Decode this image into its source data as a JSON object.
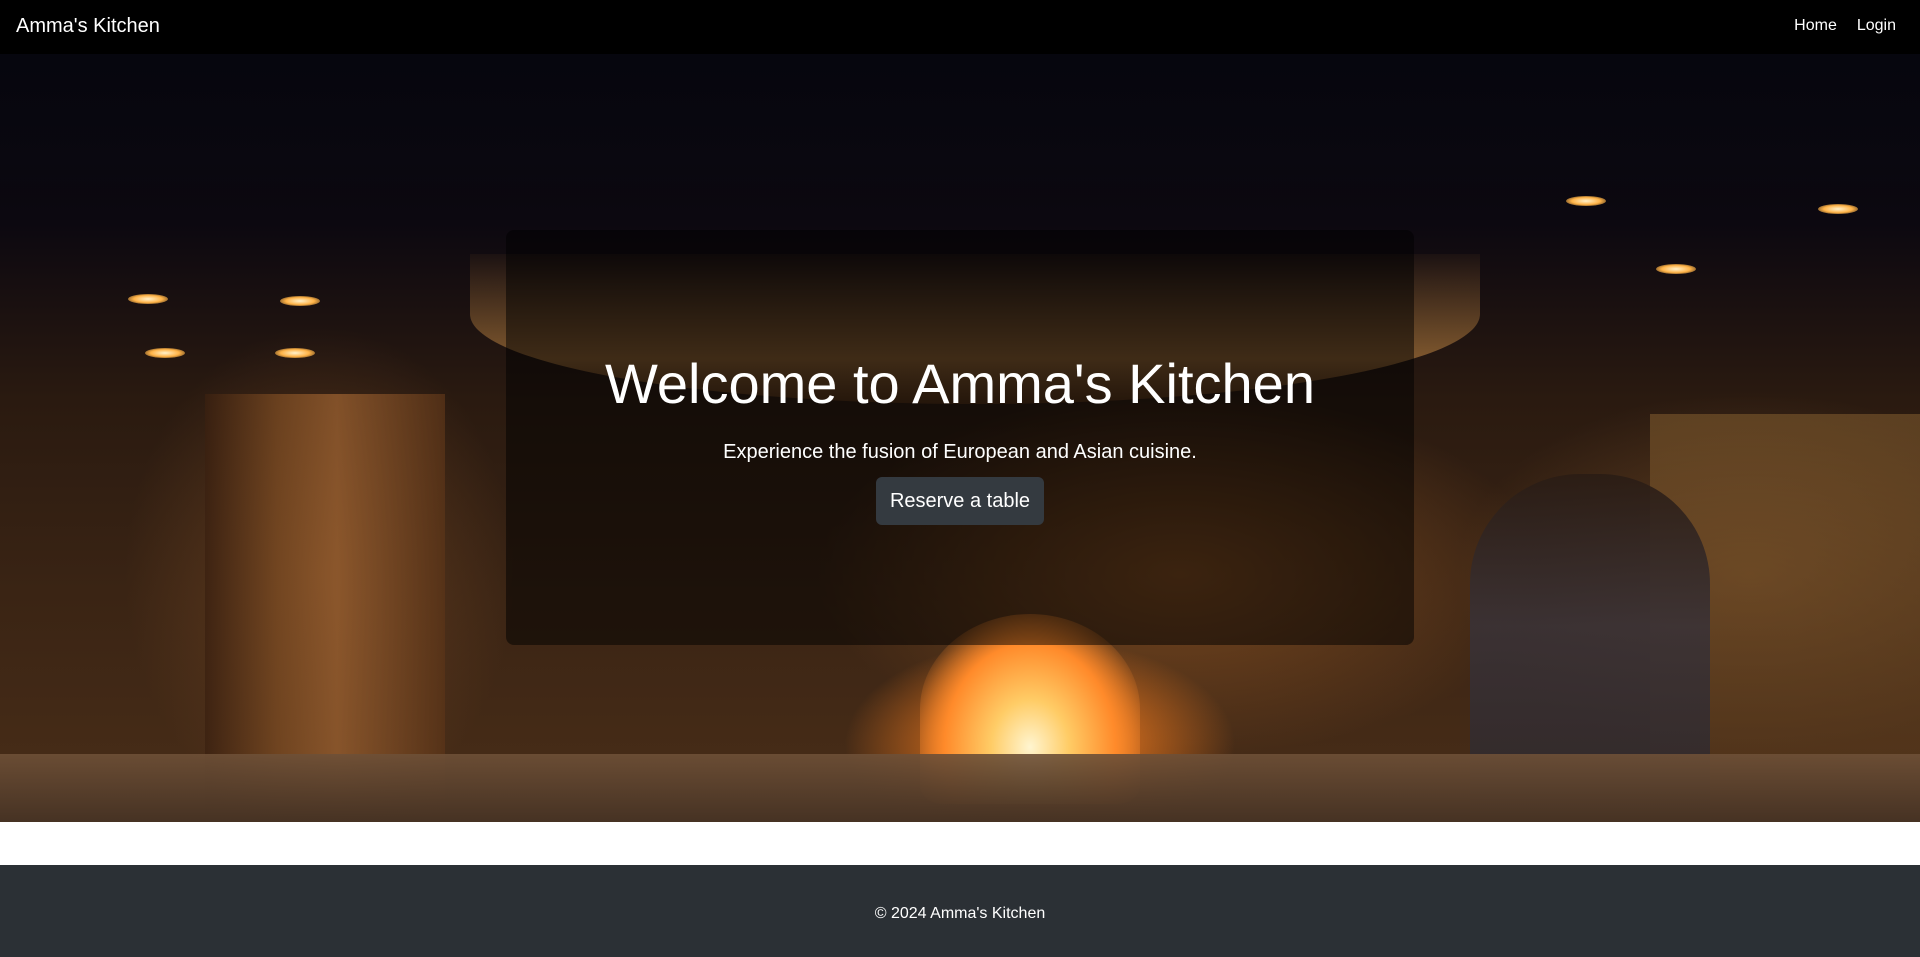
{
  "navbar": {
    "brand": "Amma's Kitchen",
    "links": [
      "Home",
      "Login"
    ]
  },
  "hero": {
    "title": "Welcome to Amma's Kitchen",
    "subtitle": "Experience the fusion of European and Asian cuisine.",
    "cta_label": "Reserve a table",
    "background_icon": "restaurant-kitchen-photo"
  },
  "footer": {
    "text": "© 2024 Amma's Kitchen"
  },
  "colors": {
    "navbar_bg": "#000000",
    "button_bg": "#343a40",
    "footer_bg": "#2b3035",
    "text": "#ffffff"
  }
}
